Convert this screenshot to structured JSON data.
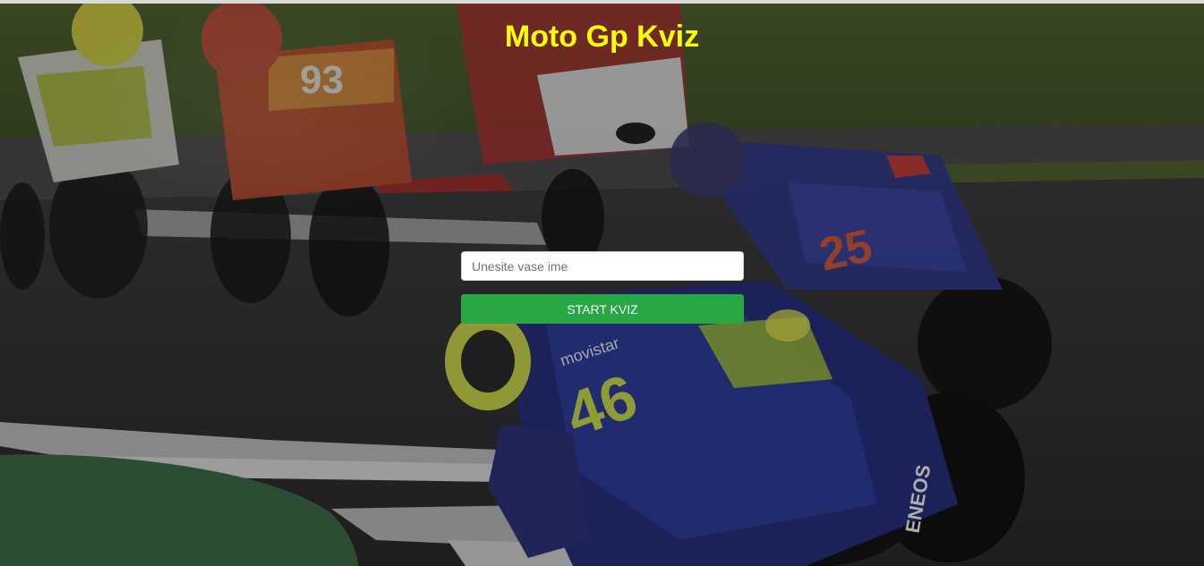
{
  "page": {
    "title": "Moto Gp Kviz"
  },
  "form": {
    "name_placeholder": "Unesite vase ime",
    "name_value": "",
    "start_label": "START KVIZ"
  },
  "colors": {
    "title": "#ffff00",
    "button": "#28a745",
    "button_text": "#ffffff"
  },
  "background": {
    "description_icon": "motogp-race-photo",
    "rider_numbers": [
      "93",
      "25",
      "46"
    ],
    "sponsor_text": [
      "movistar",
      "ENEOS"
    ]
  }
}
